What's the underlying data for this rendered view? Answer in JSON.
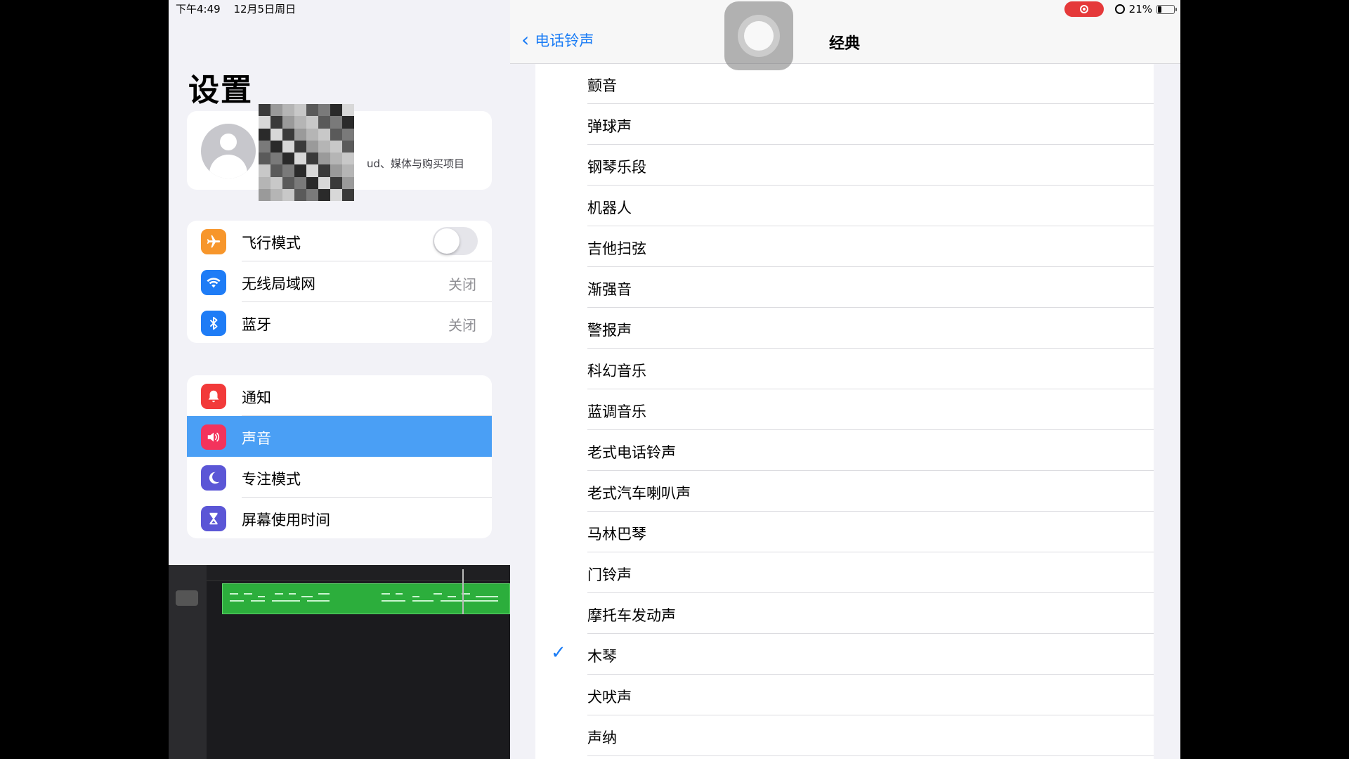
{
  "status": {
    "time": "下午4:49",
    "date": "12月5日周日",
    "battery": "21%"
  },
  "sidebar": {
    "title": "设置",
    "profile_subtitle": "ud、媒体与购买项目",
    "group1": [
      {
        "label": "飞行模式",
        "icon": "airplane-icon",
        "color": "#f7962b",
        "toggle": false
      },
      {
        "label": "无线局域网",
        "icon": "wifi-icon",
        "color": "#1e7cf6",
        "value": "关闭"
      },
      {
        "label": "蓝牙",
        "icon": "bluetooth-icon",
        "color": "#1e7cf6",
        "value": "关闭"
      }
    ],
    "group2": [
      {
        "label": "通知",
        "icon": "bell-icon",
        "color": "#f23a3a"
      },
      {
        "label": "声音",
        "icon": "speaker-icon",
        "color": "#f3335c",
        "selected": true
      },
      {
        "label": "专注模式",
        "icon": "moon-icon",
        "color": "#5b56d6"
      },
      {
        "label": "屏幕使用时间",
        "icon": "hourglass-icon",
        "color": "#5b56d6"
      }
    ]
  },
  "nav": {
    "back_label": "电话铃声",
    "title": "经典"
  },
  "ringtones": [
    {
      "label": "颤音"
    },
    {
      "label": "弹球声"
    },
    {
      "label": "钢琴乐段"
    },
    {
      "label": "机器人"
    },
    {
      "label": "吉他扫弦"
    },
    {
      "label": "渐强音"
    },
    {
      "label": "警报声"
    },
    {
      "label": "科幻音乐"
    },
    {
      "label": "蓝调音乐"
    },
    {
      "label": "老式电话铃声"
    },
    {
      "label": "老式汽车喇叭声"
    },
    {
      "label": "马林巴琴"
    },
    {
      "label": "门铃声"
    },
    {
      "label": "摩托车发动声"
    },
    {
      "label": "木琴",
      "checked": true
    },
    {
      "label": "犬吠声"
    },
    {
      "label": "声纳"
    }
  ],
  "colors": {
    "accent": "#1a7cf5",
    "selected_row": "#4a9ff5",
    "record": "#e5393a"
  }
}
